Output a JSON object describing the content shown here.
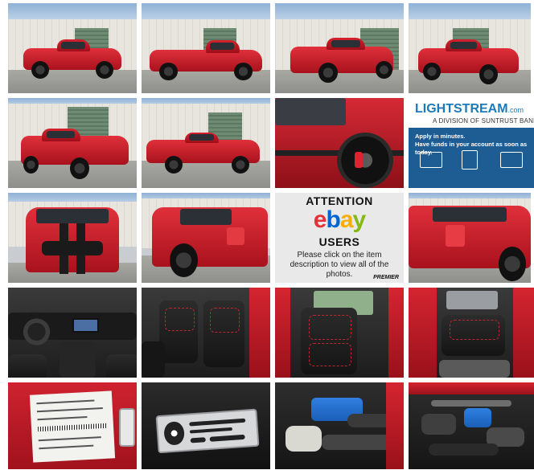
{
  "gallery": {
    "photos": [
      {
        "subject": "red truck side profile, driver side"
      },
      {
        "subject": "red truck side profile, parked at building"
      },
      {
        "subject": "red truck front three-quarter view"
      },
      {
        "subject": "red truck front three-quarter view, right"
      },
      {
        "subject": "red truck rear three-quarter view"
      },
      {
        "subject": "red truck rear side view"
      },
      {
        "subject": "wheel close-up with red caliper"
      },
      {
        "subject": "LightStream advertisement"
      },
      {
        "subject": "front view with black stripes"
      },
      {
        "subject": "rear three-quarter view close"
      },
      {
        "subject": "eBay notice"
      },
      {
        "subject": "rear view close"
      },
      {
        "subject": "dashboard interior"
      },
      {
        "subject": "front seats interior"
      },
      {
        "subject": "driver seat interior"
      },
      {
        "subject": "rear seats interior"
      },
      {
        "subject": "door jamb label"
      },
      {
        "subject": "Shelby plaque"
      },
      {
        "subject": "engine bay, supercharger"
      },
      {
        "subject": "engine bay, front"
      }
    ]
  },
  "lightstream": {
    "logo": "LIGHTSTREAM",
    "logo_suffix": ".com",
    "subtitle": "A DIVISION OF SUNTRUST BANK",
    "headline_1": "Apply in minutes.",
    "headline_2": "Have funds in your account as soon as today."
  },
  "ebay_notice": {
    "attention": "ATTENTION",
    "logo_letters": [
      "e",
      "b",
      "a",
      "y"
    ],
    "users": "USERS",
    "message": "Please click on the item description to view all of the photos.",
    "brand": "PREMIER"
  },
  "colors": {
    "ebay_e": "#e53238",
    "ebay_b": "#0064d2",
    "ebay_a": "#f5af02",
    "ebay_y": "#86b817",
    "truck_red": "#c81d28",
    "lightstream_blue": "#1e5c94"
  }
}
